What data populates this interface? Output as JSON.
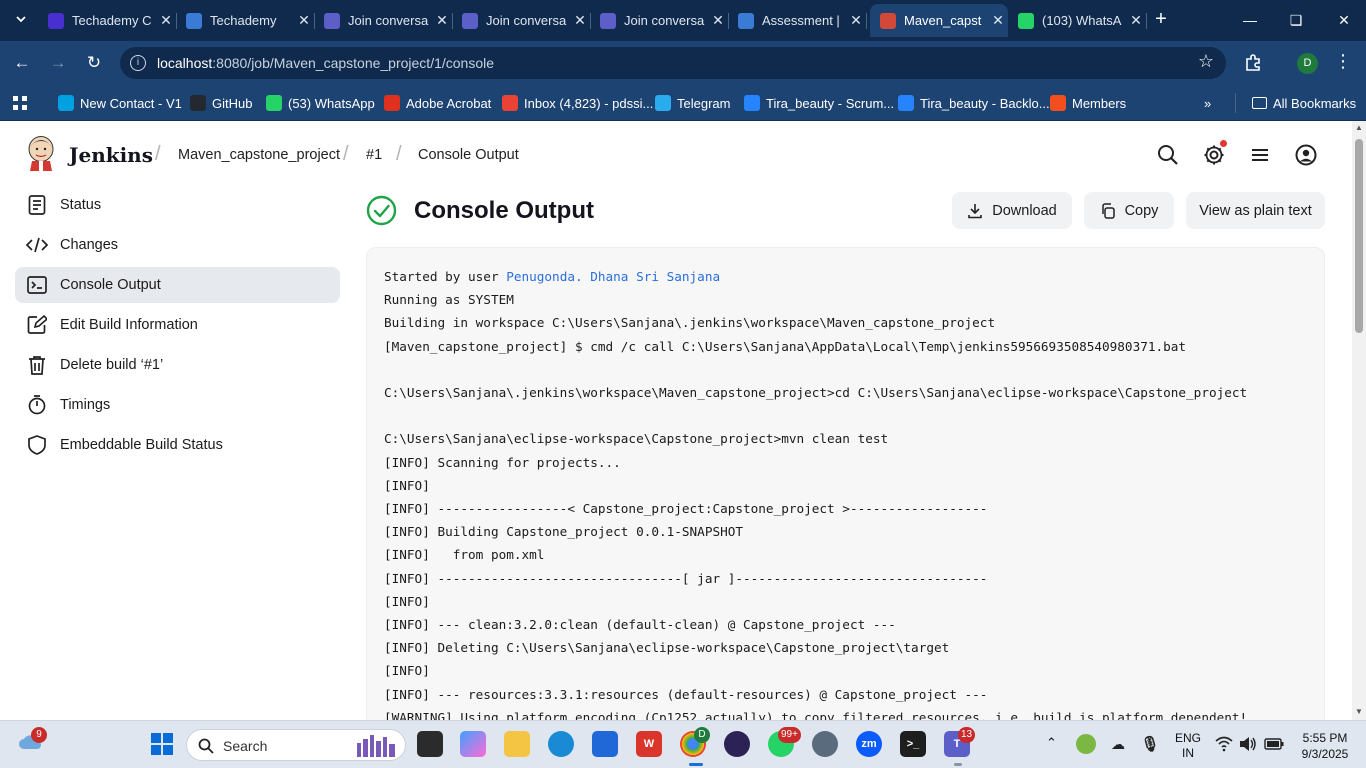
{
  "browser": {
    "tabs": [
      {
        "title": "Techademy C",
        "favicon": "techademy-icon",
        "color": "#4a2fd0"
      },
      {
        "title": "Techademy",
        "favicon": "techademy-wave-icon",
        "color": "#3a7bd5"
      },
      {
        "title": "Join conversa",
        "favicon": "teams-icon",
        "color": "#5b5fc7"
      },
      {
        "title": "Join conversa",
        "favicon": "teams-icon",
        "color": "#5b5fc7"
      },
      {
        "title": "Join conversa",
        "favicon": "teams-icon",
        "color": "#5b5fc7"
      },
      {
        "title": "Assessment |",
        "favicon": "techademy-wave-icon",
        "color": "#3a7bd5"
      },
      {
        "title": "Maven_capst",
        "favicon": "jenkins-icon",
        "color": "#d24939",
        "active": true
      },
      {
        "title": "(103) WhatsA",
        "favicon": "whatsapp-icon",
        "color": "#25d366"
      }
    ],
    "url_host": "localhost",
    "url_path": ":8080/job/Maven_capstone_project/1/console",
    "profile_initial": "D",
    "bookmarks": [
      {
        "label": "New Contact - V1",
        "icon": "salesforce-icon",
        "color": "#00a1e0"
      },
      {
        "label": "GitHub",
        "icon": "github-icon",
        "color": "#24292f"
      },
      {
        "label": "(53) WhatsApp",
        "icon": "whatsapp-icon",
        "color": "#25d366"
      },
      {
        "label": "Adobe Acrobat",
        "icon": "acrobat-icon",
        "color": "#e0301e"
      },
      {
        "label": "Inbox (4,823) - pdssi...",
        "icon": "gmail-icon",
        "color": "#ea4335"
      },
      {
        "label": "Telegram",
        "icon": "telegram-icon",
        "color": "#2aabee"
      },
      {
        "label": "Tira_beauty - Scrum...",
        "icon": "jira-icon",
        "color": "#2684ff"
      },
      {
        "label": "Tira_beauty - Backlo...",
        "icon": "jira-icon",
        "color": "#2684ff"
      },
      {
        "label": "Members",
        "icon": "members-icon",
        "color": "#f24e1e"
      }
    ],
    "all_bookmarks": "All Bookmarks"
  },
  "jenkins": {
    "brand": "Jenkins",
    "breadcrumbs": [
      "Maven_capstone_project",
      "#1",
      "Console Output"
    ],
    "sidebar": [
      {
        "label": "Status",
        "icon": "status-icon"
      },
      {
        "label": "Changes",
        "icon": "code-icon"
      },
      {
        "label": "Console Output",
        "icon": "terminal-icon",
        "active": true
      },
      {
        "label": "Edit Build Information",
        "icon": "edit-icon"
      },
      {
        "label": "Delete build ‘#1’",
        "icon": "trash-icon"
      },
      {
        "label": "Timings",
        "icon": "stopwatch-icon"
      },
      {
        "label": "Embeddable Build Status",
        "icon": "shield-icon"
      }
    ],
    "page_title": "Console Output",
    "buttons": {
      "download": "Download",
      "copy": "Copy",
      "plain": "View as plain text"
    },
    "console_user_prefix": "Started by user ",
    "console_user": "Penugonda. Dhana Sri Sanjana",
    "console_lines": [
      "Running as SYSTEM",
      "Building in workspace C:\\Users\\Sanjana\\.jenkins\\workspace\\Maven_capstone_project",
      "[Maven_capstone_project] $ cmd /c call C:\\Users\\Sanjana\\AppData\\Local\\Temp\\jenkins5956693508540980371.bat",
      "",
      "C:\\Users\\Sanjana\\.jenkins\\workspace\\Maven_capstone_project>cd C:\\Users\\Sanjana\\eclipse-workspace\\Capstone_project",
      "",
      "C:\\Users\\Sanjana\\eclipse-workspace\\Capstone_project>mvn clean test",
      "[INFO] Scanning for projects...",
      "[INFO]",
      "[INFO] -----------------< Capstone_project:Capstone_project >------------------",
      "[INFO] Building Capstone_project 0.0.1-SNAPSHOT",
      "[INFO]   from pom.xml",
      "[INFO] --------------------------------[ jar ]---------------------------------",
      "[INFO]",
      "[INFO] --- clean:3.2.0:clean (default-clean) @ Capstone_project ---",
      "[INFO] Deleting C:\\Users\\Sanjana\\eclipse-workspace\\Capstone_project\\target",
      "[INFO]",
      "[INFO] --- resources:3.3.1:resources (default-resources) @ Capstone_project ---",
      "[WARNING] Using platform encoding (Cp1252 actually) to copy filtered resources, i.e. build is platform dependent!"
    ]
  },
  "taskbar": {
    "widgets_badge": "9",
    "search_label": "Search",
    "whatsapp_badge": "99+",
    "teams_badge": "13",
    "chrome_profile": "D",
    "lang_line1": "ENG",
    "lang_line2": "IN",
    "time": "5:55 PM",
    "date": "9/3/2025"
  }
}
